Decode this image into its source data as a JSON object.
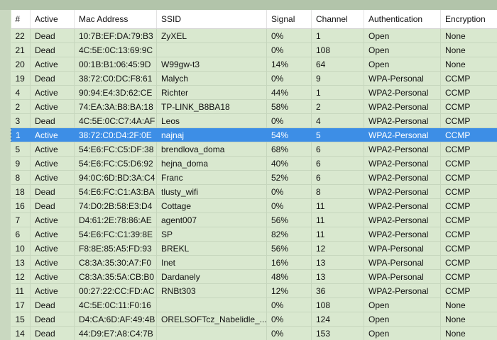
{
  "columns": [
    "#",
    "Active",
    "Mac Address",
    "SSID",
    "Signal",
    "Channel",
    "Authentication",
    "Encryption"
  ],
  "selected_index": 7,
  "rows": [
    {
      "num": "22",
      "active": "Dead",
      "mac": "10:7B:EF:DA:79:B3",
      "ssid": "ZyXEL",
      "signal": "0%",
      "channel": "1",
      "auth": "Open",
      "enc": "None"
    },
    {
      "num": "21",
      "active": "Dead",
      "mac": "4C:5E:0C:13:69:9C",
      "ssid": "",
      "signal": "0%",
      "channel": "108",
      "auth": "Open",
      "enc": "None"
    },
    {
      "num": "20",
      "active": "Active",
      "mac": "00:1B:B1:06:45:9D",
      "ssid": "W99gw-t3",
      "signal": "14%",
      "channel": "64",
      "auth": "Open",
      "enc": "None"
    },
    {
      "num": "19",
      "active": "Dead",
      "mac": "38:72:C0:DC:F8:61",
      "ssid": "Malych",
      "signal": "0%",
      "channel": "9",
      "auth": "WPA-Personal",
      "enc": "CCMP"
    },
    {
      "num": "4",
      "active": "Active",
      "mac": "90:94:E4:3D:62:CE",
      "ssid": "Richter",
      "signal": "44%",
      "channel": "1",
      "auth": "WPA2-Personal",
      "enc": "CCMP"
    },
    {
      "num": "2",
      "active": "Active",
      "mac": "74:EA:3A:B8:BA:18",
      "ssid": "TP-LINK_B8BA18",
      "signal": "58%",
      "channel": "2",
      "auth": "WPA2-Personal",
      "enc": "CCMP"
    },
    {
      "num": "3",
      "active": "Dead",
      "mac": "4C:5E:0C:C7:4A:AF",
      "ssid": "Leos",
      "signal": "0%",
      "channel": "4",
      "auth": "WPA2-Personal",
      "enc": "CCMP"
    },
    {
      "num": "1",
      "active": "Active",
      "mac": "38:72:C0:D4:2F:0E",
      "ssid": "najnaj",
      "signal": "54%",
      "channel": "5",
      "auth": "WPA2-Personal",
      "enc": "CCMP"
    },
    {
      "num": "5",
      "active": "Active",
      "mac": "54:E6:FC:C5:DF:38",
      "ssid": "brendlova_doma",
      "signal": "68%",
      "channel": "6",
      "auth": "WPA2-Personal",
      "enc": "CCMP"
    },
    {
      "num": "9",
      "active": "Active",
      "mac": "54:E6:FC:C5:D6:92",
      "ssid": "hejna_doma",
      "signal": "40%",
      "channel": "6",
      "auth": "WPA2-Personal",
      "enc": "CCMP"
    },
    {
      "num": "8",
      "active": "Active",
      "mac": "94:0C:6D:BD:3A:C4",
      "ssid": "Franc",
      "signal": "52%",
      "channel": "6",
      "auth": "WPA2-Personal",
      "enc": "CCMP"
    },
    {
      "num": "18",
      "active": "Dead",
      "mac": "54:E6:FC:C1:A3:BA",
      "ssid": "tlusty_wifi",
      "signal": "0%",
      "channel": "8",
      "auth": "WPA2-Personal",
      "enc": "CCMP"
    },
    {
      "num": "16",
      "active": "Dead",
      "mac": "74:D0:2B:58:E3:D4",
      "ssid": "Cottage",
      "signal": "0%",
      "channel": "11",
      "auth": "WPA2-Personal",
      "enc": "CCMP"
    },
    {
      "num": "7",
      "active": "Active",
      "mac": "D4:61:2E:78:86:AE",
      "ssid": "agent007",
      "signal": "56%",
      "channel": "11",
      "auth": "WPA2-Personal",
      "enc": "CCMP"
    },
    {
      "num": "6",
      "active": "Active",
      "mac": "54:E6:FC:C1:39:8E",
      "ssid": "SP",
      "signal": "82%",
      "channel": "11",
      "auth": "WPA2-Personal",
      "enc": "CCMP"
    },
    {
      "num": "10",
      "active": "Active",
      "mac": "F8:8E:85:A5:FD:93",
      "ssid": "BREKL",
      "signal": "56%",
      "channel": "12",
      "auth": "WPA-Personal",
      "enc": "CCMP"
    },
    {
      "num": "13",
      "active": "Active",
      "mac": "C8:3A:35:30:A7:F0",
      "ssid": "Inet",
      "signal": "16%",
      "channel": "13",
      "auth": "WPA-Personal",
      "enc": "CCMP"
    },
    {
      "num": "12",
      "active": "Active",
      "mac": "C8:3A:35:5A:CB:B0",
      "ssid": "Dardanely",
      "signal": "48%",
      "channel": "13",
      "auth": "WPA-Personal",
      "enc": "CCMP"
    },
    {
      "num": "11",
      "active": "Active",
      "mac": "00:27:22:CC:FD:AC",
      "ssid": "RNBt303",
      "signal": "12%",
      "channel": "36",
      "auth": "WPA2-Personal",
      "enc": "CCMP"
    },
    {
      "num": "17",
      "active": "Dead",
      "mac": "4C:5E:0C:11:F0:16",
      "ssid": "",
      "signal": "0%",
      "channel": "108",
      "auth": "Open",
      "enc": "None"
    },
    {
      "num": "15",
      "active": "Dead",
      "mac": "D4:CA:6D:AF:49:4B",
      "ssid": "ORELSOFTcz_Nabelidle_...",
      "signal": "0%",
      "channel": "124",
      "auth": "Open",
      "enc": "None"
    },
    {
      "num": "14",
      "active": "Dead",
      "mac": "44:D9:E7:A8:C4:7B",
      "ssid": "",
      "signal": "0%",
      "channel": "153",
      "auth": "Open",
      "enc": "None"
    }
  ]
}
